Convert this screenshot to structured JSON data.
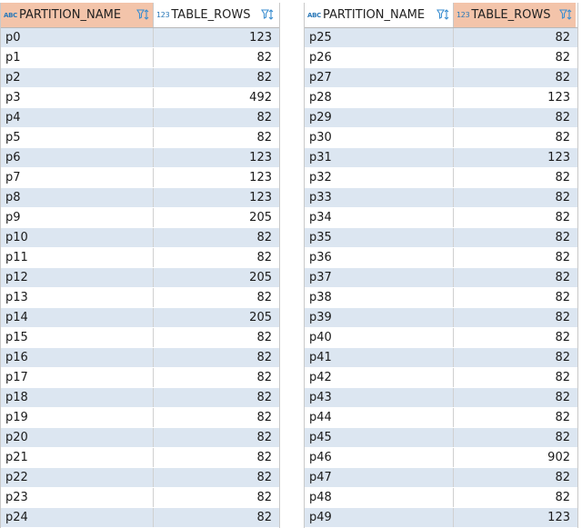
{
  "headers": {
    "name_type": "ABC",
    "name_label": "PARTITION_NAME",
    "rows_type": "123",
    "rows_label": "TABLE_ROWS"
  },
  "left_table": [
    {
      "name": "p0",
      "rows": "123"
    },
    {
      "name": "p1",
      "rows": "82"
    },
    {
      "name": "p2",
      "rows": "82"
    },
    {
      "name": "p3",
      "rows": "492"
    },
    {
      "name": "p4",
      "rows": "82"
    },
    {
      "name": "p5",
      "rows": "82"
    },
    {
      "name": "p6",
      "rows": "123"
    },
    {
      "name": "p7",
      "rows": "123"
    },
    {
      "name": "p8",
      "rows": "123"
    },
    {
      "name": "p9",
      "rows": "205"
    },
    {
      "name": "p10",
      "rows": "82"
    },
    {
      "name": "p11",
      "rows": "82"
    },
    {
      "name": "p12",
      "rows": "205"
    },
    {
      "name": "p13",
      "rows": "82"
    },
    {
      "name": "p14",
      "rows": "205"
    },
    {
      "name": "p15",
      "rows": "82"
    },
    {
      "name": "p16",
      "rows": "82"
    },
    {
      "name": "p17",
      "rows": "82"
    },
    {
      "name": "p18",
      "rows": "82"
    },
    {
      "name": "p19",
      "rows": "82"
    },
    {
      "name": "p20",
      "rows": "82"
    },
    {
      "name": "p21",
      "rows": "82"
    },
    {
      "name": "p22",
      "rows": "82"
    },
    {
      "name": "p23",
      "rows": "82"
    },
    {
      "name": "p24",
      "rows": "82"
    }
  ],
  "right_table": [
    {
      "name": "p25",
      "rows": "82"
    },
    {
      "name": "p26",
      "rows": "82"
    },
    {
      "name": "p27",
      "rows": "82"
    },
    {
      "name": "p28",
      "rows": "123"
    },
    {
      "name": "p29",
      "rows": "82"
    },
    {
      "name": "p30",
      "rows": "82"
    },
    {
      "name": "p31",
      "rows": "123"
    },
    {
      "name": "p32",
      "rows": "82"
    },
    {
      "name": "p33",
      "rows": "82"
    },
    {
      "name": "p34",
      "rows": "82"
    },
    {
      "name": "p35",
      "rows": "82"
    },
    {
      "name": "p36",
      "rows": "82"
    },
    {
      "name": "p37",
      "rows": "82"
    },
    {
      "name": "p38",
      "rows": "82"
    },
    {
      "name": "p39",
      "rows": "82"
    },
    {
      "name": "p40",
      "rows": "82"
    },
    {
      "name": "p41",
      "rows": "82"
    },
    {
      "name": "p42",
      "rows": "82"
    },
    {
      "name": "p43",
      "rows": "82"
    },
    {
      "name": "p44",
      "rows": "82"
    },
    {
      "name": "p45",
      "rows": "82"
    },
    {
      "name": "p46",
      "rows": "902"
    },
    {
      "name": "p47",
      "rows": "82"
    },
    {
      "name": "p48",
      "rows": "82"
    },
    {
      "name": "p49",
      "rows": "123"
    }
  ],
  "colors": {
    "selected_header": "#f3c4aa",
    "stripe": "#dce6f1",
    "icon_blue": "#3b8ed0"
  },
  "icons": {
    "type_text": "abc-type-icon",
    "type_number": "numeric-type-icon",
    "filter_sort": "filter-sort-icon"
  }
}
